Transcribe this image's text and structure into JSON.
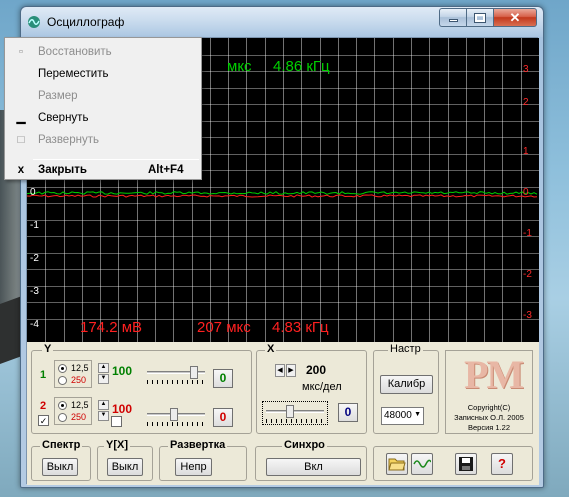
{
  "window": {
    "title": "Осциллограф"
  },
  "menu": {
    "items": [
      {
        "label": "Восстановить",
        "enabled": false,
        "icon": "restore-icon"
      },
      {
        "label": "Переместить",
        "enabled": true,
        "icon": ""
      },
      {
        "label": "Размер",
        "enabled": false,
        "icon": ""
      },
      {
        "label": "Свернуть",
        "enabled": true,
        "icon": "minimize-icon"
      },
      {
        "label": "Развернуть",
        "enabled": false,
        "icon": "maximize-icon"
      },
      {
        "label": "Закрыть",
        "enabled": true,
        "icon": "close-icon",
        "shortcut": "Alt+F4"
      }
    ]
  },
  "scope": {
    "y_left_labels": [
      "0",
      "-1",
      "-2",
      "-3",
      "-4"
    ],
    "y_right_labels": [
      "3",
      "2",
      "1",
      "0",
      "-1",
      "-2",
      "-3"
    ],
    "top_readout": {
      "time": "мкс",
      "freq": "4.86 кГц"
    },
    "bottom_readout": {
      "voltage": "174.2 мВ",
      "time": "207 мкс",
      "freq": "4.83 кГц"
    },
    "colors": {
      "ch1": "#00d000",
      "ch2": "#ff2020",
      "grid": "#ffffff",
      "bg": "#000000"
    }
  },
  "y_group": {
    "label": "Y",
    "ch1": {
      "num": "1",
      "opt_a": "12,5",
      "opt_b": "250",
      "value": "100",
      "reset": "0",
      "selected": "12,5",
      "slider_level": 0.85
    },
    "ch2": {
      "num": "2",
      "opt_a": "12,5",
      "opt_b": "250",
      "value": "100",
      "reset": "0",
      "selected": "12,5",
      "enabled": true,
      "slider_level": 0.45
    }
  },
  "x_group": {
    "label": "X",
    "value": "200",
    "unit": "мкс/дел",
    "reset": "0",
    "slider_level": 0.4
  },
  "settings_group": {
    "label": "Настр",
    "calib": "Калибр",
    "rate": "48000"
  },
  "about": {
    "logo": "PM",
    "line1": "Copyright(C)",
    "line2": "Записных О.Л. 2005",
    "line3": "Версия 1.22"
  },
  "bottom": {
    "spectr": {
      "label": "Спектр",
      "button": "Выкл"
    },
    "yx": {
      "label": "Y[X]",
      "button": "Выкл"
    },
    "sweep": {
      "label": "Развертка",
      "button": "Непр"
    },
    "sync": {
      "label": "Синхро",
      "button": "Вкл"
    },
    "help": "?"
  }
}
